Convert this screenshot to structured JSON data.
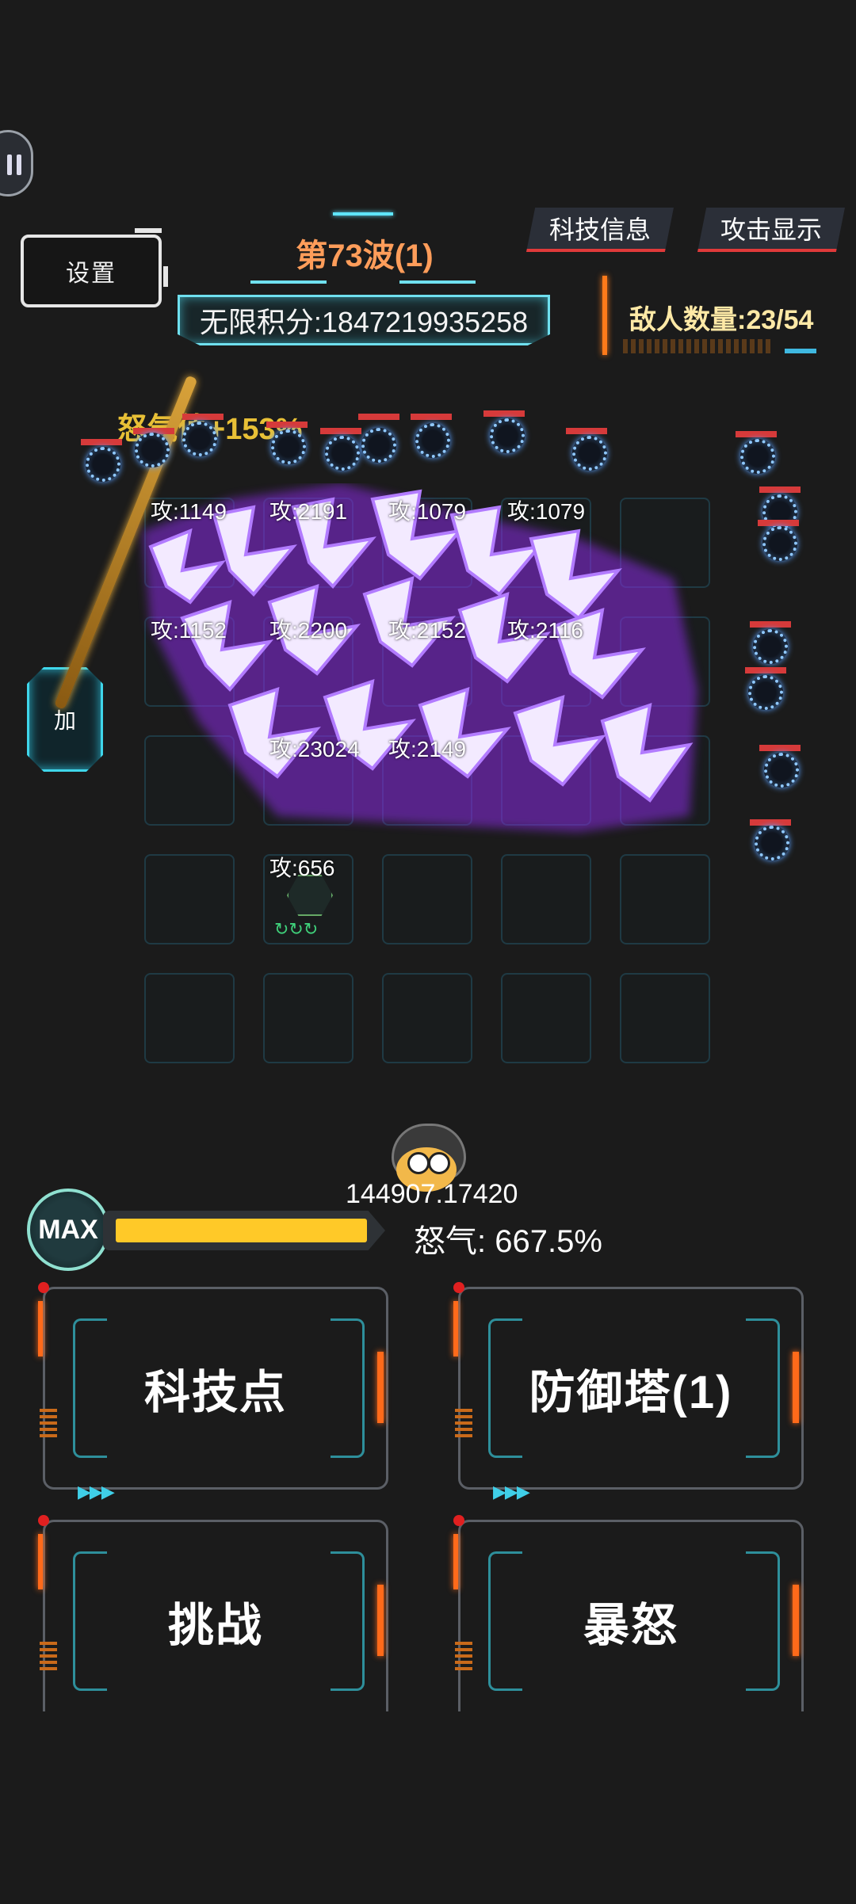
{
  "hud": {
    "settings_label": "设置",
    "wave_label": "第73波(1)",
    "score_label": "无限积分:1847219935258",
    "tech_info_label": "科技信息",
    "attack_display_label": "攻击显示",
    "enemy_count_label": "敌人数量:23/54",
    "add_label": "加",
    "rage_bonus_label": "怒气值+153%"
  },
  "towers": [
    {
      "attack": "攻:1149"
    },
    {
      "attack": "攻:2191"
    },
    {
      "attack": "攻:1079"
    },
    {
      "attack": "攻:1079"
    },
    {
      "attack": "攻:1152"
    },
    {
      "attack": "攻:2200"
    },
    {
      "attack": "攻:2152"
    },
    {
      "attack": "攻:2116"
    },
    {
      "attack": "攻:23024"
    },
    {
      "attack": "攻:2149"
    },
    {
      "attack": "攻:656"
    }
  ],
  "player": {
    "score": "144907.17420",
    "level_badge": "MAX",
    "rage_label": "怒气: 667.5%",
    "rage_fill": 0.95
  },
  "actions": {
    "tech_points": "科技点",
    "defense_tower": "防御塔(1)",
    "challenge": "挑战",
    "fury": "暴怒"
  },
  "colors": {
    "accent_cyan": "#6fe0ef",
    "accent_orange": "#ff6a1a",
    "rage_yellow": "#ffc928",
    "blast_purple": "#9b3dff"
  }
}
